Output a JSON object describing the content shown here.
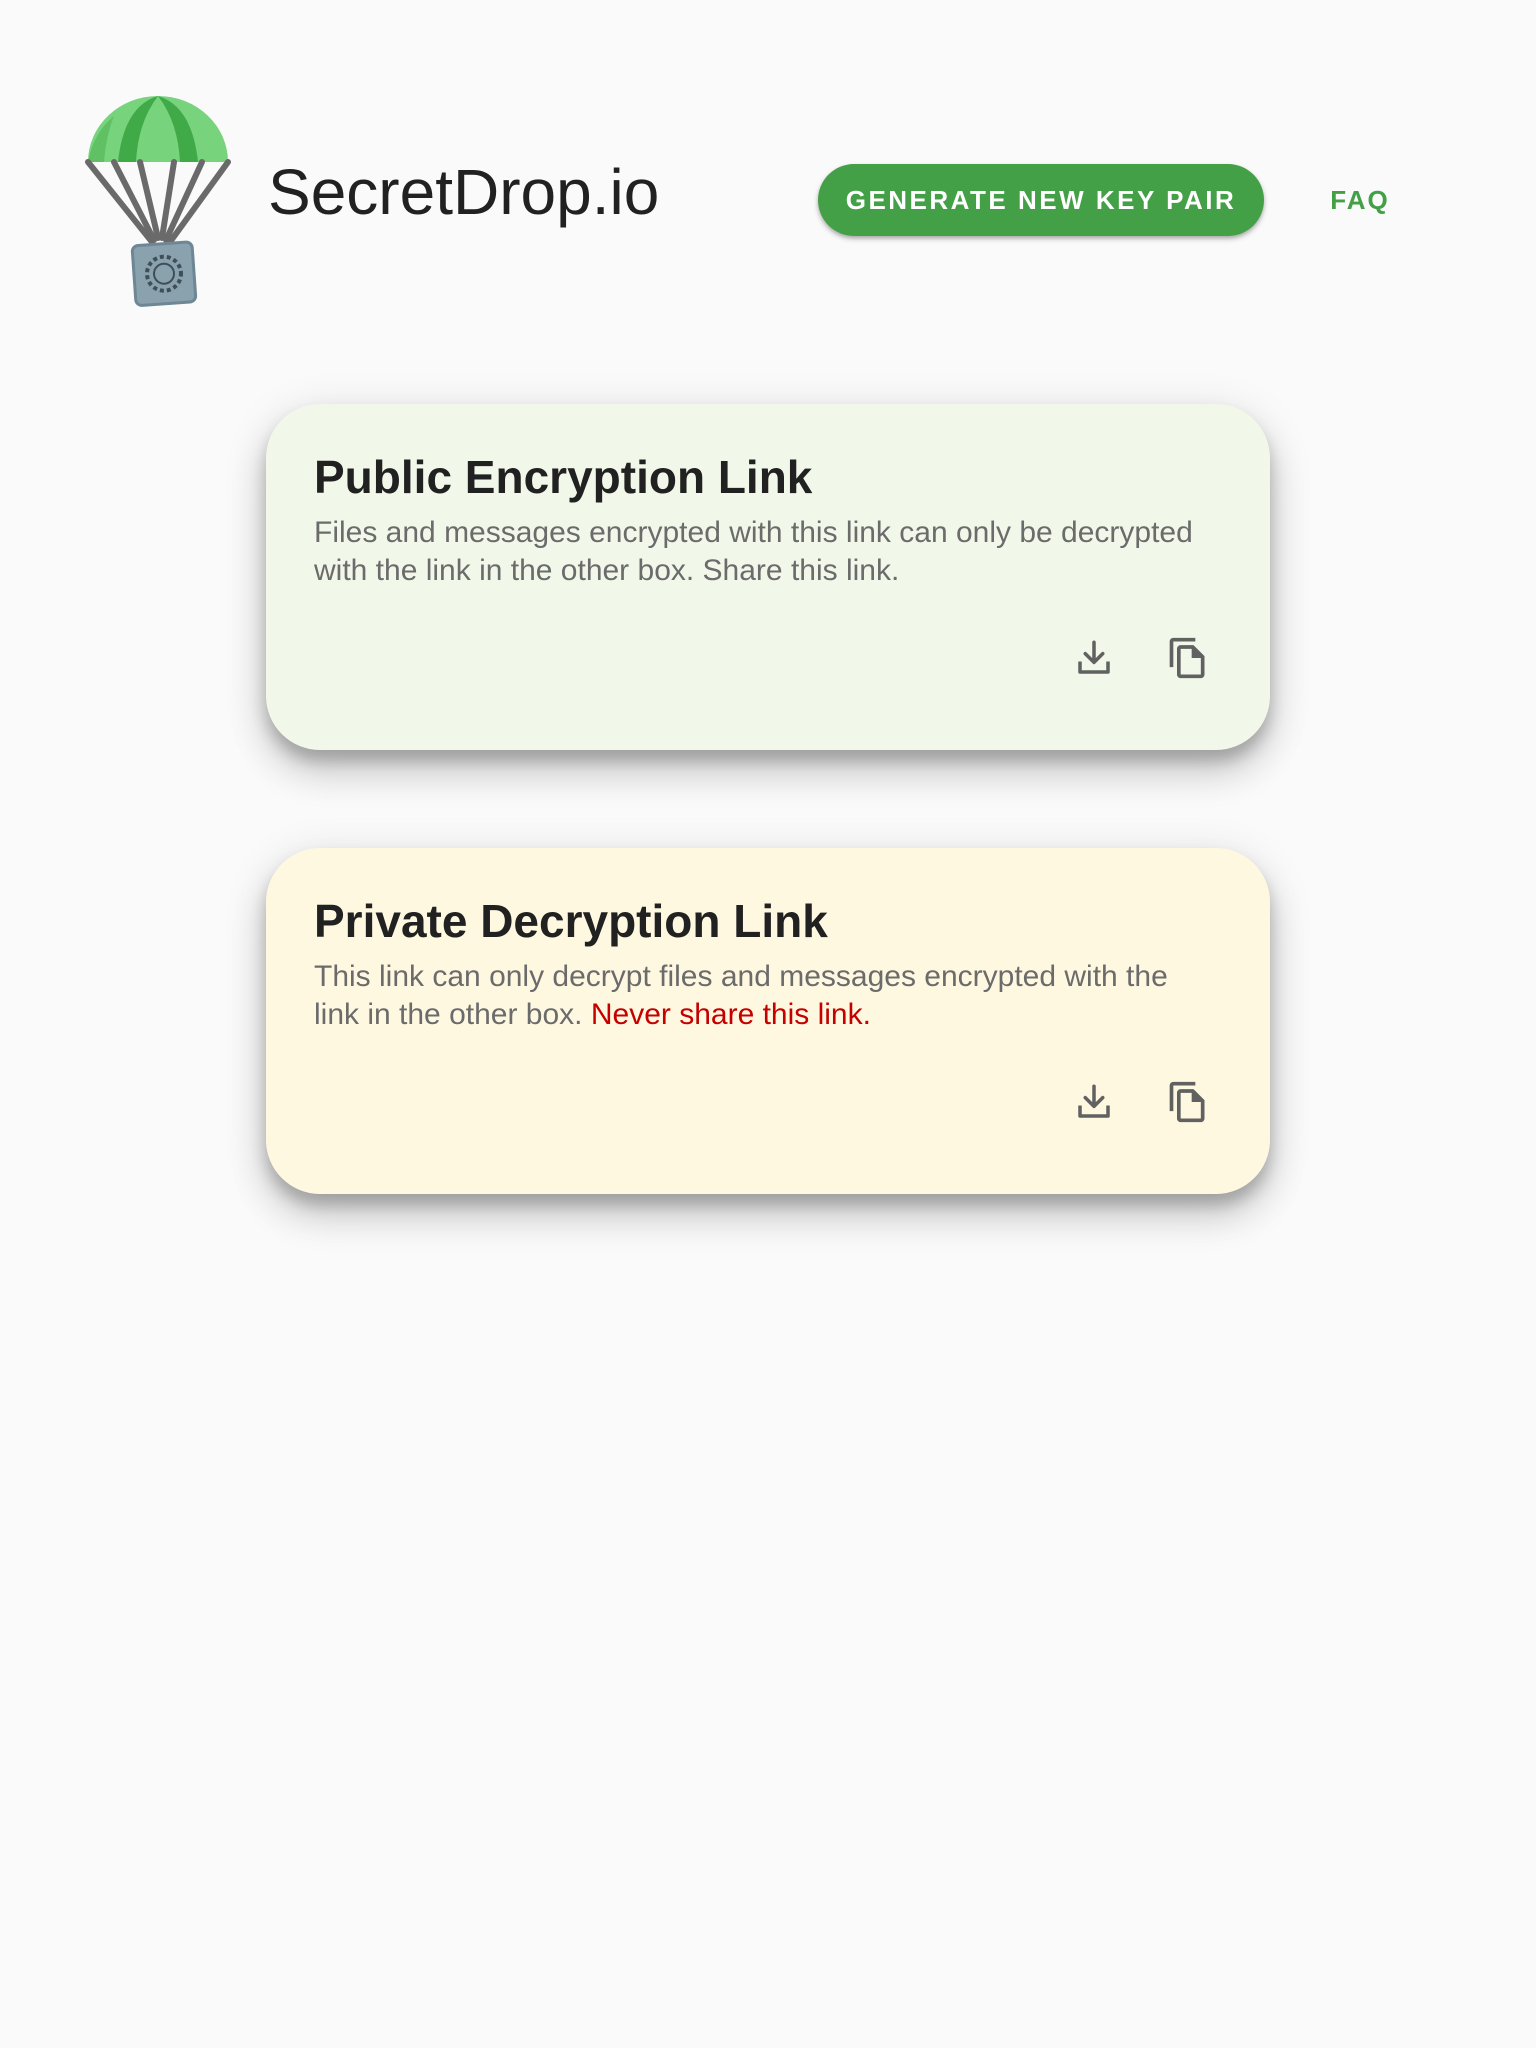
{
  "header": {
    "site_title": "SecretDrop.io",
    "generate_button_label": "GENERATE NEW KEY PAIR",
    "faq_label": "FAQ"
  },
  "cards": [
    {
      "title": "Public Encryption Link",
      "description": "Files and messages encrypted with this link can only be decrypted with the link in the other box. Share this link.",
      "background": "#f1f8e9",
      "icons": [
        "download-icon",
        "copy-icon"
      ]
    },
    {
      "title": "Private Decryption Link",
      "description": "This link can only decrypt files and messages encrypted with the link in the other box.",
      "warning": "Never share this link.",
      "background": "#fff8e1",
      "icons": [
        "download-icon",
        "copy-icon"
      ]
    }
  ],
  "colors": {
    "accent": "#43a047",
    "warning": "#c40000",
    "page_background": "#fafafa"
  }
}
